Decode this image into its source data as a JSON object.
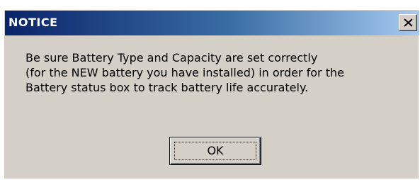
{
  "window": {
    "title": "NOTICE",
    "close_icon": "close-x-icon"
  },
  "message": {
    "lines": [
      "Be sure Battery Type and Capacity are set correctly",
      "(for the NEW battery you have installed) in order for the",
      "Battery status box to track battery life accurately."
    ]
  },
  "buttons": {
    "ok_label": "OK"
  },
  "colors": {
    "titlebar_start": "#0a246a",
    "titlebar_end": "#a6caf0",
    "dialog_face": "#d4d0c8"
  }
}
